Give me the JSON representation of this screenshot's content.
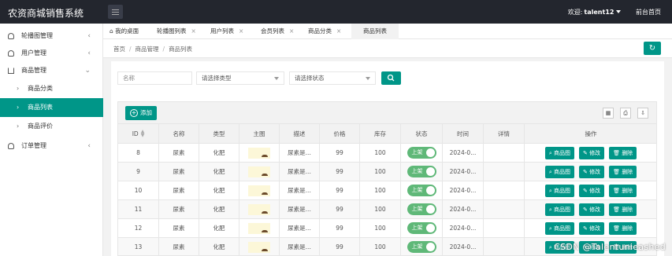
{
  "app": {
    "title": "农资商城销售系统",
    "welcome": "欢迎:",
    "user": "talent12",
    "frontpage": "前台首页"
  },
  "sidebar": {
    "items": [
      {
        "label": "轮播图管理",
        "arrow": "‹"
      },
      {
        "label": "用户管理",
        "arrow": "‹"
      },
      {
        "label": "商品管理",
        "arrow": "⌄"
      },
      {
        "label": "订单管理",
        "arrow": "‹"
      }
    ],
    "subitems": [
      {
        "label": "商品分类"
      },
      {
        "label": "商品列表"
      },
      {
        "label": "商品评价"
      }
    ]
  },
  "tabs": [
    {
      "label": "我的桌面"
    },
    {
      "label": "轮播图列表",
      "close": "×"
    },
    {
      "label": "用户列表",
      "close": "×"
    },
    {
      "label": "会员列表",
      "close": "×"
    },
    {
      "label": "商品分类",
      "close": "×"
    },
    {
      "label": "商品列表"
    }
  ],
  "breadcrumb": [
    "首页",
    "商品管理",
    "商品列表"
  ],
  "breadcrumb_sep": "/",
  "filters": {
    "name_placeholder": "名称",
    "type_placeholder": "请选择类型",
    "status_placeholder": "请选择状态"
  },
  "toolbar": {
    "add_label": "添加",
    "icons": [
      "columns-icon",
      "print-icon",
      "export-icon"
    ]
  },
  "table": {
    "headers": [
      "ID",
      "名称",
      "类型",
      "主图",
      "描述",
      "价格",
      "库存",
      "状态",
      "时间",
      "详情",
      "操作"
    ],
    "rows": [
      {
        "id": "8",
        "name": "尿素",
        "type": "化肥",
        "desc": "尿素是...",
        "price": "99",
        "stock": "100",
        "status": "上架",
        "time": "2024-0..."
      },
      {
        "id": "9",
        "name": "尿素",
        "type": "化肥",
        "desc": "尿素是...",
        "price": "99",
        "stock": "100",
        "status": "上架",
        "time": "2024-0..."
      },
      {
        "id": "10",
        "name": "尿素",
        "type": "化肥",
        "desc": "尿素是...",
        "price": "99",
        "stock": "100",
        "status": "上架",
        "time": "2024-0..."
      },
      {
        "id": "11",
        "name": "尿素",
        "type": "化肥",
        "desc": "尿素是...",
        "price": "99",
        "stock": "100",
        "status": "上架",
        "time": "2024-0..."
      },
      {
        "id": "12",
        "name": "尿素",
        "type": "化肥",
        "desc": "尿素是...",
        "price": "99",
        "stock": "100",
        "status": "上架",
        "time": "2024-0..."
      },
      {
        "id": "13",
        "name": "尿素",
        "type": "化肥",
        "desc": "尿素是...",
        "price": "99",
        "stock": "100",
        "status": "上架",
        "time": "2024-0..."
      }
    ],
    "ops": {
      "image": "商品图",
      "edit": "修改",
      "delete": "删除"
    }
  },
  "watermark": "CSDN @Talentunieashed",
  "colors": {
    "accent": "#009688",
    "topbar": "#23262e",
    "switch_on": "#5fb878"
  }
}
